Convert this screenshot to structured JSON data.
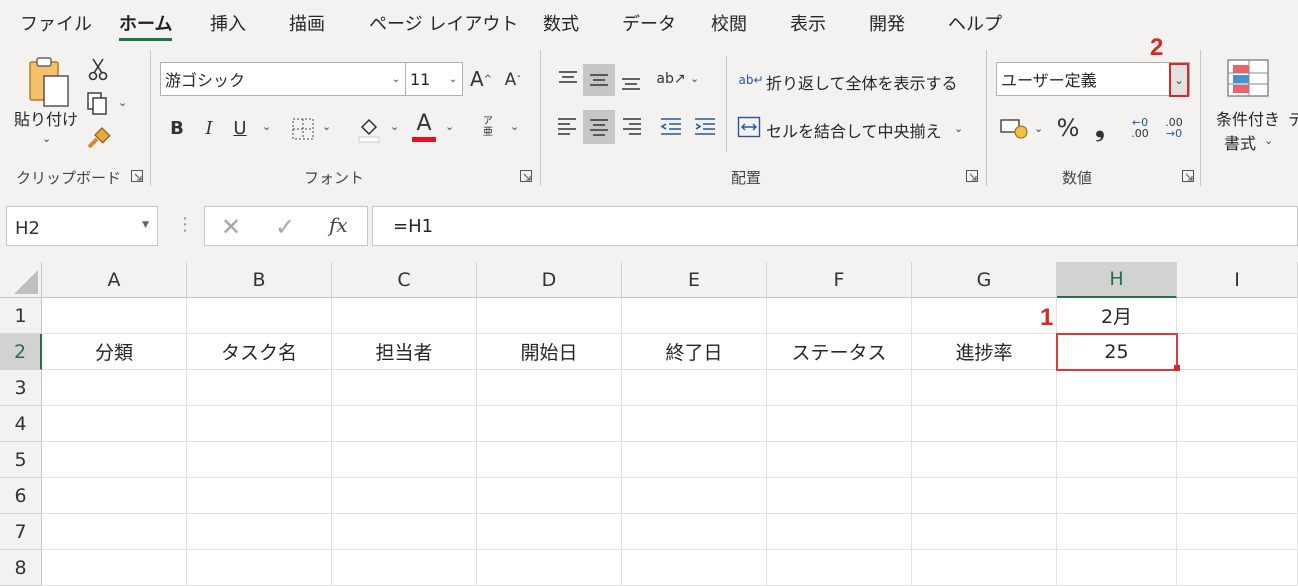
{
  "menu": {
    "tabs": [
      "ファイル",
      "ホーム",
      "挿入",
      "描画",
      "ページ レイアウト",
      "数式",
      "データ",
      "校閲",
      "表示",
      "開発",
      "ヘルプ"
    ],
    "active": "ホーム"
  },
  "ribbon": {
    "clipboard": {
      "paste_label": "貼り付け",
      "group_label": "クリップボード"
    },
    "font": {
      "font_name": "游ゴシック",
      "font_size": "11",
      "bold": "B",
      "italic": "I",
      "underline": "U",
      "font_color_glyph": "A",
      "grow_glyph": "A",
      "shrink_glyph": "A",
      "phonetic_glyph": "ア\n亜",
      "group_label": "フォント"
    },
    "alignment": {
      "wrap_text": "折り返して全体を表示する",
      "merge_center": "セルを結合して中央揃え",
      "group_label": "配置"
    },
    "number": {
      "format_value": "ユーザー定義",
      "percent": "%",
      "comma": "❟",
      "group_label": "数値"
    },
    "styles": {
      "conditional_line1": "条件付き",
      "conditional_line2": "書式"
    }
  },
  "formula_bar": {
    "name_box": "H2",
    "formula": "=H1",
    "fx": "fx"
  },
  "sheet": {
    "columns": [
      "A",
      "B",
      "C",
      "D",
      "E",
      "F",
      "G",
      "H",
      "I"
    ],
    "rows": [
      "1",
      "2",
      "3",
      "4",
      "5",
      "6",
      "7",
      "8"
    ],
    "selected_column": "H",
    "selected_row": "2",
    "cells": {
      "H1": "2月",
      "A2": "分類",
      "B2": "タスク名",
      "C2": "担当者",
      "D2": "開始日",
      "E2": "終了日",
      "F2": "ステータス",
      "G2": "進捗率",
      "H2": "25"
    }
  },
  "annotations": {
    "step1": "1",
    "step2": "2",
    "color": "#d72828"
  },
  "colors": {
    "excel_green": "#217346",
    "font_red": "#e81123"
  }
}
